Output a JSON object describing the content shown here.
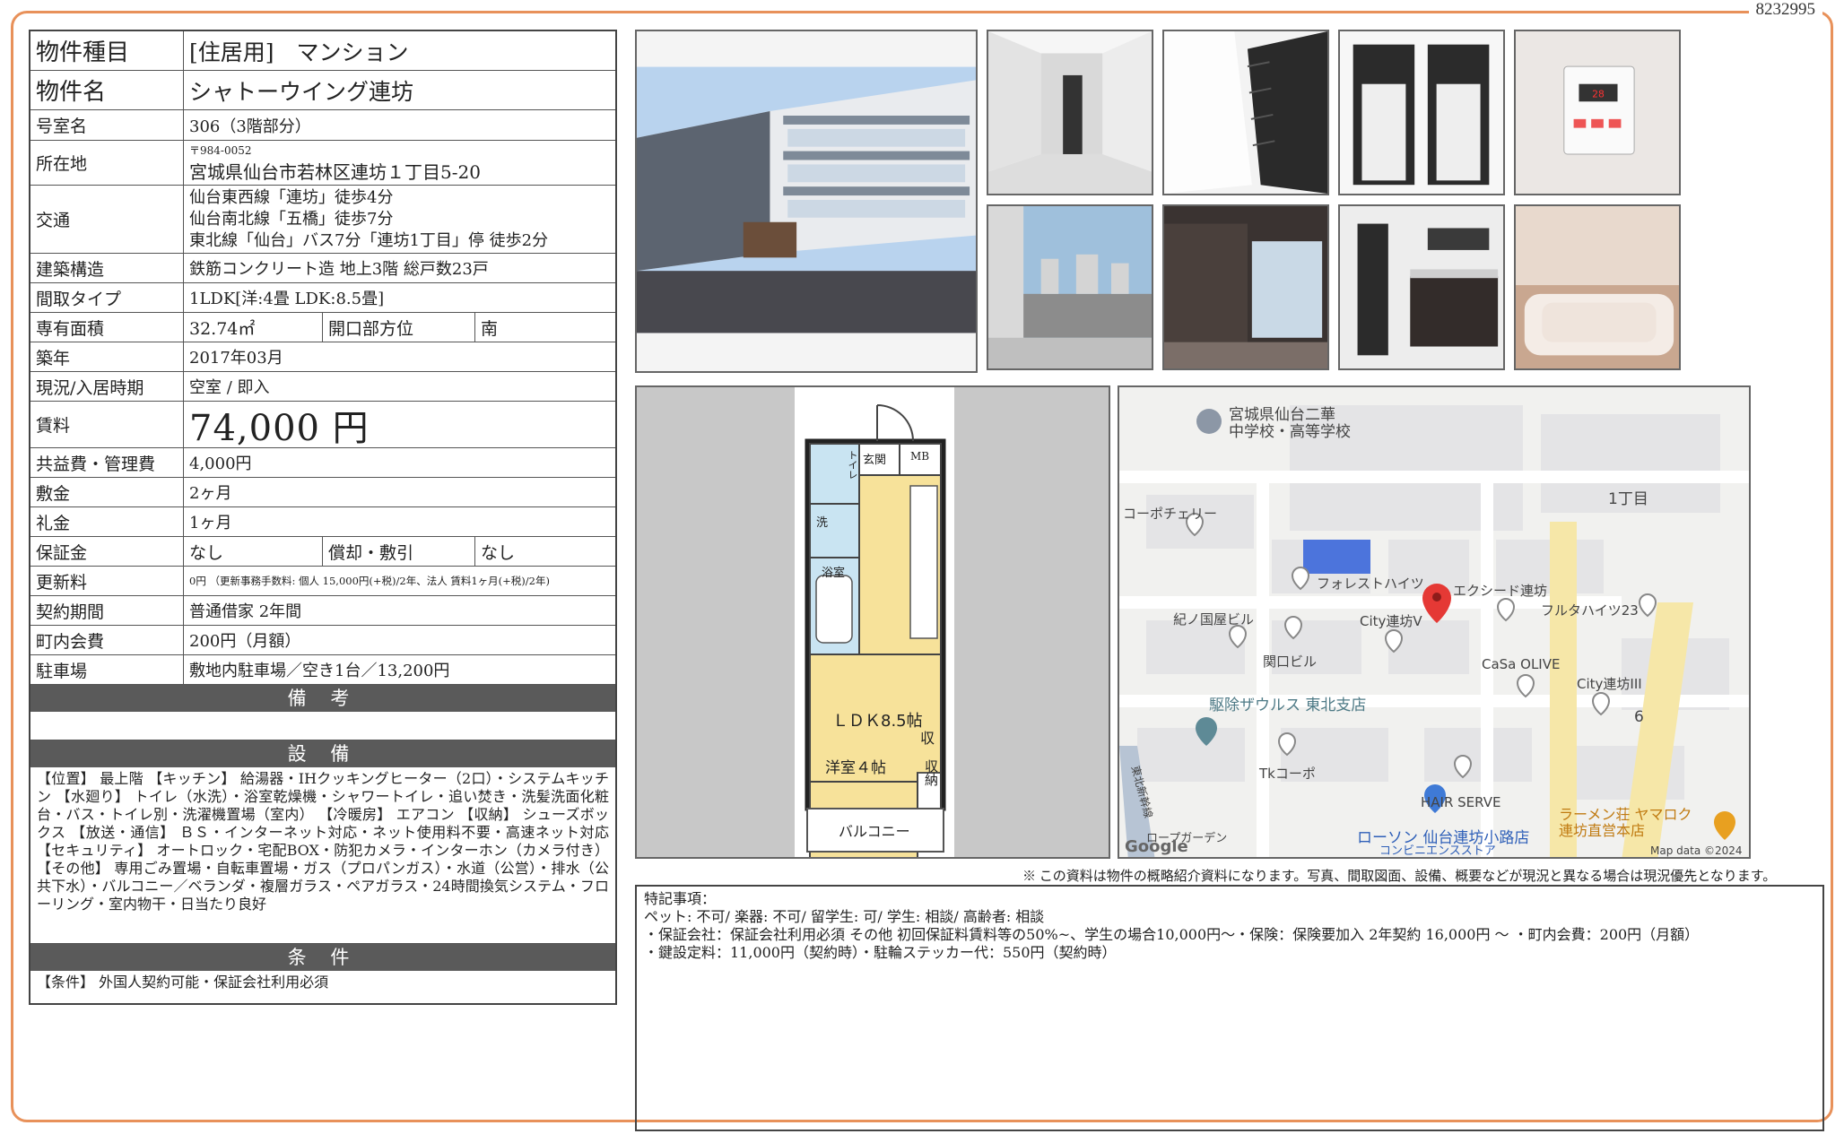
{
  "doc_number": "8232995",
  "property": {
    "type_label": "物件種目",
    "type_value": "[住居用]　マンション",
    "name_label": "物件名",
    "name_value": "シャトーウイング連坊",
    "room_label": "号室名",
    "room_value": "306（3階部分）",
    "address_label": "所在地",
    "postal": "〒984-0052",
    "address_value": "宮城県仙台市若林区連坊１丁目5-20",
    "transport_label": "交通",
    "transport_lines": [
      "仙台東西線「連坊」徒歩4分",
      "仙台南北線「五橋」徒歩7分",
      "東北線「仙台」バス7分「連坊1丁目」停 徒歩2分"
    ],
    "structure_label": "建築構造",
    "structure_value": "鉄筋コンクリート造 地上3階 総戸数23戸",
    "layout_label": "間取タイプ",
    "layout_value": "1LDK[洋:4畳 LDK:8.5畳]",
    "area_label": "専有面積",
    "area_value": "32.74㎡",
    "direction_label": "開口部方位",
    "direction_value": "南",
    "built_label": "築年",
    "built_value": "2017年03月",
    "status_label": "現況/入居時期",
    "status_value": "空室 /  即入",
    "rent_label": "賃料",
    "rent_value": "74,000 円",
    "fee_label": "共益費・管理費",
    "fee_value": "4,000円",
    "deposit_label": "敷金",
    "deposit_value": "2ヶ月",
    "keymoney_label": "礼金",
    "keymoney_value": "1ヶ月",
    "guarantee_label": "保証金",
    "guarantee_value": "なし",
    "amort_label": "償却・敷引",
    "amort_value": "なし",
    "renewal_label": "更新料",
    "renewal_value": "0円 （更新事務手数料: 個人 15,000円(+税)/2年、法人 賃料1ヶ月(+税)/2年)",
    "contract_label": "契約期間",
    "contract_value": "普通借家 2年間",
    "community_label": "町内会費",
    "community_value": "200円（月額）",
    "parking_label": "駐車場",
    "parking_value": "敷地内駐車場／空き1台／13,200円"
  },
  "sections": {
    "remarks_title": "備 考",
    "equipment_title": "設 備",
    "equipment_text": "【位置】 最上階 【キッチン】 給湯器・IHクッキングヒーター（2口）・システムキッチン 【水廻り】 トイレ（水洗）・浴室乾燥機・シャワートイレ・追い焚き・洗髪洗面化粧台・バス・トイレ別・洗濯機置場（室内） 【冷暖房】 エアコン 【収納】 シューズボックス 【放送・通信】 ＢＳ・インターネット対応・ネット使用料不要・高速ネット対応 【セキュリティ】 オートロック・宅配BOX・防犯カメラ・インターホン（カメラ付き） 【その他】 専用ごみ置場・自転車置場・ガス（プロパンガス）・水道（公営）・排水（公共下水）・バルコニー／ベランダ・複層ガラス・ペアガラス・24時間換気システム・フローリング・室内物干・日当たり良好",
    "conditions_title": "条 件",
    "conditions_text": "【条件】 外国人契約可能・保証会社利用必須"
  },
  "floorplan": {
    "entrance": "玄関",
    "mb": "MB",
    "toilet": "トイレ",
    "wash": "洗",
    "bath": "浴室",
    "ldk": "ＬＤＫ8.5帖",
    "western": "洋室４帖",
    "storage1": "収",
    "storage2": "収納",
    "balcony": "バルコニー"
  },
  "map": {
    "school": "宮城県仙台二華\n中学校・高等学校",
    "chome1": "1丁目",
    "coop": "コーポチェリー",
    "forest": "フォレストハイツ",
    "excede": "エクシード連坊",
    "kinokuniya": "紀ノ国屋ビル",
    "cityv": "City連坊V",
    "furuta": "フルタハイツ23",
    "sekiguchi": "関口ビル",
    "casa": "CaSa OLIVE",
    "cityiii": "City連坊III",
    "six": "6",
    "kujo": "駆除ザウルス 東北支店",
    "tk": "Tkコーポ",
    "hair": "HAIR SERVE",
    "lawson": "ローソン 仙台連坊小路店",
    "conv": "コンビニエンスストア",
    "ramen": "ラーメン荘 ヤマロク\n連坊直営本店",
    "shinkansen": "東北新幹線",
    "rope": "ロープガーデン",
    "google": "Google",
    "mapdata": "Map data ©2024"
  },
  "notice": "※ この資料は物件の概略紹介資料になります。写真、間取図面、設備、概要などが現況と異なる場合は現況優先となります。",
  "special": {
    "title": "特記事項：",
    "line1": "ペット: 不可/ 楽器: 不可/ 留学生: 可/ 学生: 相談/ 高齢者: 相談",
    "line2": "・保証会社：保証会社利用必須 その他 初回保証料賃料等の50%~、学生の場合10,000円～・保険：保険要加入 2年契約 16,000円 ～ ・町内会費：200円（月額）",
    "line3": "・鍵設定料：11,000円（契約時）・駐輪ステッカー代：550円（契約時）"
  },
  "colors": {
    "frame": "#e8915a",
    "section": "#5a5a5a",
    "floor_yellow": "#f7e29a",
    "floor_blue": "#c9e4f2",
    "map_pin": "#e53935"
  }
}
